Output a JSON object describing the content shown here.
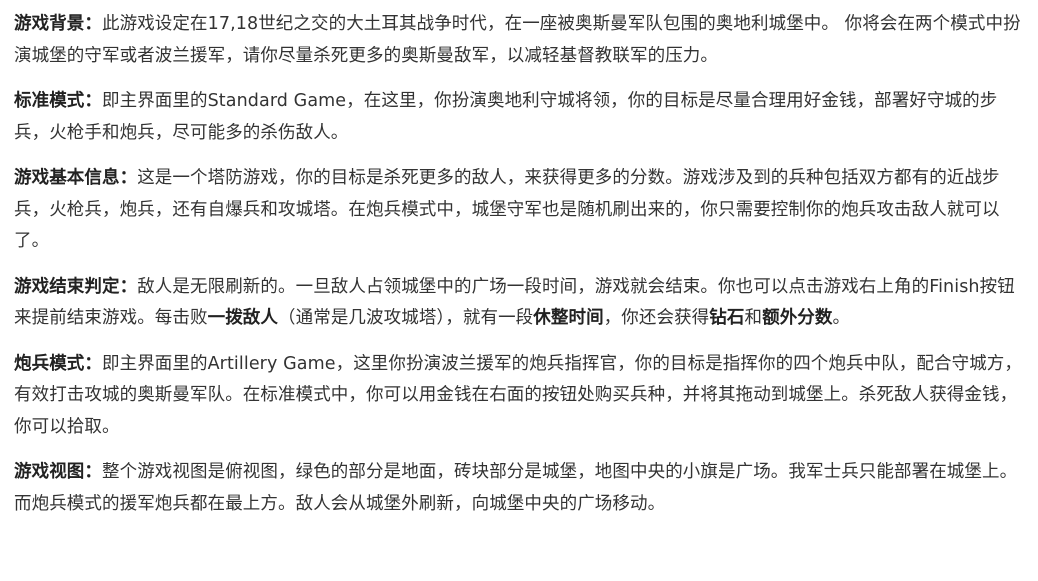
{
  "article": {
    "paragraphs": [
      {
        "segments": [
          {
            "text": "游戏背景：",
            "bold": true
          },
          {
            "text": "此游戏设定在17,18世纪之交的大土耳其战争时代，在一座被奥斯曼军队包围的奥地利城堡中。 你将会在两个模式中扮演城堡的守军或者波兰援军，请你尽量杀死更多的奥斯曼敌军，以减轻基督教联军的压力。",
            "bold": false
          }
        ]
      },
      {
        "segments": [
          {
            "text": "标准模式：",
            "bold": true
          },
          {
            "text": "即主界面里的Standard Game，在这里，你扮演奥地利守城将领，你的目标是尽量合理用好金钱，部署好守城的步兵，火枪手和炮兵，尽可能多的杀伤敌人。",
            "bold": false
          }
        ]
      },
      {
        "segments": [
          {
            "text": "游戏基本信息：",
            "bold": true
          },
          {
            "text": "这是一个塔防游戏，你的目标是杀死更多的敌人，来获得更多的分数。游戏涉及到的兵种包括双方都有的近战步兵，火枪兵，炮兵，还有自爆兵和攻城塔。在炮兵模式中，城堡守军也是随机刷出来的，你只需要控制你的炮兵攻击敌人就可以了。",
            "bold": false
          }
        ]
      },
      {
        "segments": [
          {
            "text": "游戏结束判定：",
            "bold": true
          },
          {
            "text": "敌人是无限刷新的。一旦敌人占领城堡中的广场一段时间，游戏就会结束。你也可以点击游戏右上角的Finish按钮来提前结束游戏。每击败",
            "bold": false
          },
          {
            "text": "一拨敌人",
            "bold": true
          },
          {
            "text": "（通常是几波攻城塔），就有一段",
            "bold": false
          },
          {
            "text": "休整时间",
            "bold": true
          },
          {
            "text": "，你还会获得",
            "bold": false
          },
          {
            "text": "钻石",
            "bold": true
          },
          {
            "text": "和",
            "bold": false
          },
          {
            "text": "额外分数",
            "bold": true
          },
          {
            "text": "。",
            "bold": false
          }
        ]
      },
      {
        "segments": [
          {
            "text": "炮兵模式：",
            "bold": true
          },
          {
            "text": "即主界面里的Artillery Game，这里你扮演波兰援军的炮兵指挥官，你的目标是指挥你的四个炮兵中队，配合守城方，有效打击攻城的奥斯曼军队。在标准模式中，你可以用金钱在右面的按钮处购买兵种，并将其拖动到城堡上。杀死敌人获得金钱，你可以拾取。",
            "bold": false
          }
        ]
      },
      {
        "segments": [
          {
            "text": "游戏视图：",
            "bold": true
          },
          {
            "text": "整个游戏视图是俯视图，绿色的部分是地面，砖块部分是城堡，地图中央的小旗是广场。我军士兵只能部署在城堡上。而炮兵模式的援军炮兵都在最上方。敌人会从城堡外刷新，向城堡中央的广场移动。",
            "bold": false
          }
        ]
      }
    ]
  }
}
